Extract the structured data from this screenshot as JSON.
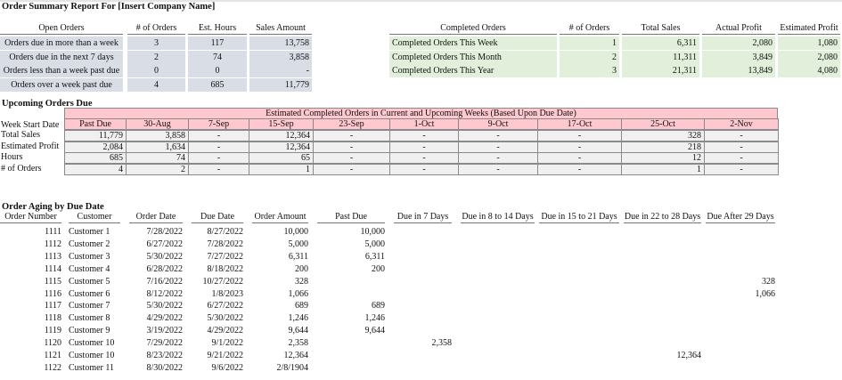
{
  "report_title": "Order Summary Report For [Insert Company Name]",
  "open_orders": {
    "headers": [
      "Open Orders",
      "# of Orders",
      "Est. Hours",
      "Sales Amount"
    ],
    "rows": [
      [
        "Orders due in more than a week",
        "3",
        "117",
        "13,758"
      ],
      [
        "Orders due in the next 7 days",
        "2",
        "74",
        "3,858"
      ],
      [
        "Orders less than a week past due",
        "0",
        "0",
        "-"
      ],
      [
        "Orders over a week past due",
        "4",
        "685",
        "11,779"
      ]
    ]
  },
  "completed_orders": {
    "headers": [
      "Completed Orders",
      "# of Orders",
      "Total Sales",
      "Actual Profit",
      "Estimated Profit"
    ],
    "rows": [
      [
        "Completed Orders This Week",
        "1",
        "6,311",
        "2,080",
        "1,080"
      ],
      [
        "Completed Orders This Month",
        "2",
        "11,311",
        "3,849",
        "2,080"
      ],
      [
        "Completed Orders This Year",
        "3",
        "21,311",
        "13,849",
        "4,080"
      ]
    ]
  },
  "upcoming": {
    "title": "Upcoming Orders Due",
    "banner": "Estimated Completed Orders in Current and Upcoming Weeks (Based Upon Due Date)",
    "row_label_header": "Week Start Date",
    "weeks": [
      "Past Due",
      "30-Aug",
      "7-Sep",
      "15-Sep",
      "23-Sep",
      "1-Oct",
      "9-Oct",
      "17-Oct",
      "25-Oct",
      "2-Nov"
    ],
    "rows": [
      {
        "label": "Total Sales",
        "values": [
          "11,779",
          "3,858",
          "-",
          "12,364",
          "-",
          "-",
          "-",
          "-",
          "328",
          "-"
        ]
      },
      {
        "label": "Estimated Profit",
        "values": [
          "2,084",
          "1,634",
          "-",
          "12,364",
          "-",
          "-",
          "-",
          "-",
          "218",
          "-"
        ]
      },
      {
        "label": "Hours",
        "values": [
          "685",
          "74",
          "-",
          "65",
          "-",
          "-",
          "-",
          "-",
          "12",
          "-"
        ]
      },
      {
        "label": "# of Orders",
        "values": [
          "4",
          "2",
          "-",
          "1",
          "-",
          "-",
          "-",
          "-",
          "1",
          "-"
        ]
      }
    ]
  },
  "aging": {
    "title": "Order Aging by Due Date",
    "headers": [
      "Order Number",
      "Customer",
      "Order Date",
      "Due Date",
      "Order Amount",
      "Past Due",
      "Due in 7 Days",
      "Due in 8 to 14 Days",
      "Due in 15 to 21 Days",
      "Due in 22 to 28 Days",
      "Due After 29 Days"
    ],
    "rows": [
      [
        "1111",
        "Customer 1",
        "7/28/2022",
        "8/27/2022",
        "10,000",
        "10,000",
        "",
        "",
        "",
        "",
        ""
      ],
      [
        "1112",
        "Customer 2",
        "6/27/2022",
        "7/28/2022",
        "5,000",
        "5,000",
        "",
        "",
        "",
        "",
        ""
      ],
      [
        "1113",
        "Customer 3",
        "5/30/2022",
        "7/27/2022",
        "6,311",
        "6,311",
        "",
        "",
        "",
        "",
        ""
      ],
      [
        "1114",
        "Customer 4",
        "6/28/2022",
        "8/18/2022",
        "200",
        "200",
        "",
        "",
        "",
        "",
        ""
      ],
      [
        "1115",
        "Customer 5",
        "7/16/2022",
        "10/27/2022",
        "328",
        "",
        "",
        "",
        "",
        "",
        "328"
      ],
      [
        "1116",
        "Customer 6",
        "8/12/2022",
        "1/8/2023",
        "1,066",
        "",
        "",
        "",
        "",
        "",
        "1,066"
      ],
      [
        "1117",
        "Customer 7",
        "5/30/2022",
        "6/27/2022",
        "689",
        "689",
        "",
        "",
        "",
        "",
        ""
      ],
      [
        "1118",
        "Customer 8",
        "4/29/2022",
        "5/30/2022",
        "1,246",
        "1,246",
        "",
        "",
        "",
        "",
        ""
      ],
      [
        "1119",
        "Customer 9",
        "3/19/2022",
        "4/29/2022",
        "9,644",
        "9,644",
        "",
        "",
        "",
        "",
        ""
      ],
      [
        "1120",
        "Customer 10",
        "7/29/2022",
        "9/1/2022",
        "2,358",
        "",
        "2,358",
        "",
        "",
        "",
        ""
      ],
      [
        "1121",
        "Customer 10",
        "8/23/2022",
        "9/21/2022",
        "12,364",
        "",
        "",
        "",
        "",
        "12,364",
        ""
      ],
      [
        "1122",
        "Customer 11",
        "8/30/2022",
        "9/6/2022",
        "2/8/1904",
        "",
        "",
        "",
        "",
        "",
        ""
      ]
    ]
  }
}
